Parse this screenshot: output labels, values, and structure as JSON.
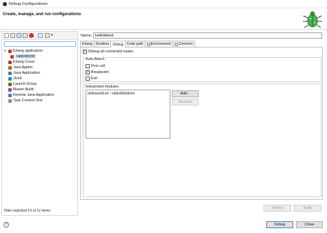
{
  "window": {
    "title": "Debug Configurations"
  },
  "header": {
    "title": "Create, manage, and run configurations"
  },
  "left": {
    "filter_placeholder": "",
    "tree": [
      {
        "label": "Erlang application",
        "expanded": true,
        "color": "#c0392b"
      },
      {
        "label": "HelloWorld",
        "selected": true,
        "color": "#c0392b"
      },
      {
        "label": "Erlang Cover",
        "color": "#c0392b"
      },
      {
        "label": "Java Applet",
        "color": "#d35400"
      },
      {
        "label": "Java Application",
        "color": "#2e86c1"
      },
      {
        "label": "JUnit",
        "color": "#2e86c1"
      },
      {
        "label": "Launch Group",
        "color": "#7d6608"
      },
      {
        "label": "Maven Build",
        "color": "#8e44ad"
      },
      {
        "label": "Remote Java Application",
        "color": "#2e86c1"
      },
      {
        "label": "Task Context Test",
        "color": "#7f8c8d"
      }
    ],
    "status": "Filter matched 10 of 12 items"
  },
  "right": {
    "name_label": "Name:",
    "name_value": "HelloWorld",
    "tabs": [
      "Erlang",
      "Runtime",
      "Debug",
      "Code path",
      "Environment",
      "Common"
    ],
    "active_tab": "Debug",
    "debug_all_nodes": {
      "label": "Debug all connected nodes",
      "checked": true
    },
    "auto_attach": {
      "title": "Auto Attach",
      "first_call": {
        "label": "First call",
        "checked": false
      },
      "breakpoint": {
        "label": "Breakpoint",
        "checked": true
      },
      "exit": {
        "label": "Exit",
        "checked": false
      }
    },
    "interpreted": {
      "title": "Interpreted modules",
      "items": [
        "helloworld.erl - HelloWorld/src"
      ],
      "add_label": "Add...",
      "remove_label": "Remove"
    },
    "revert_label": "Revert",
    "apply_label": "Apply"
  },
  "footer": {
    "debug_label": "Debug",
    "close_label": "Close"
  },
  "colors": {
    "selection": "#cde2f7",
    "accent": "#3c7fd1"
  }
}
